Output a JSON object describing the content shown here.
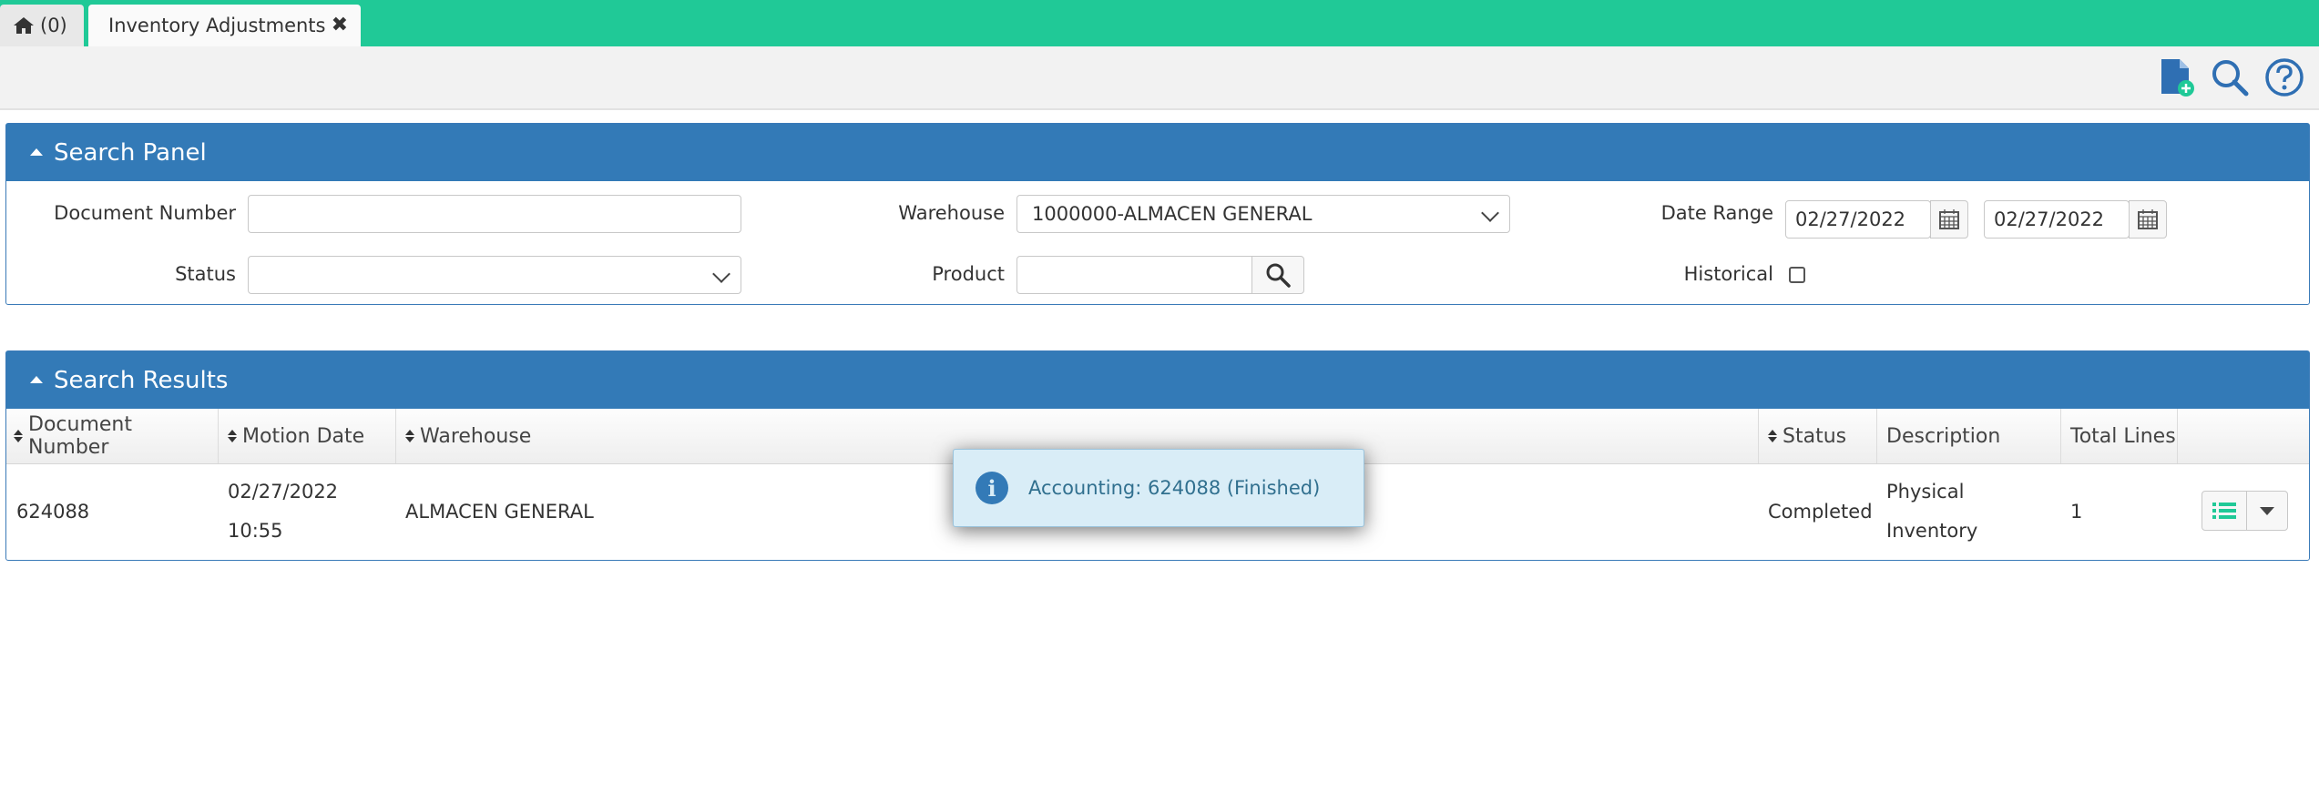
{
  "tabs": {
    "home_label": "(0)",
    "active_label": "Inventory Adjustments",
    "close_glyph": "✖"
  },
  "toolbar": {
    "icons": [
      "new-document-icon",
      "search-icon",
      "help-icon"
    ],
    "accent": "#337ab7"
  },
  "search_panel": {
    "title": "Search Panel",
    "document_number": {
      "label": "Document Number",
      "value": ""
    },
    "warehouse": {
      "label": "Warehouse",
      "value": "1000000-ALMACEN GENERAL"
    },
    "date_range": {
      "label": "Date Range",
      "from": "02/27/2022",
      "to": "02/27/2022"
    },
    "status": {
      "label": "Status",
      "value": ""
    },
    "product": {
      "label": "Product",
      "value": ""
    },
    "historical": {
      "label": "Historical",
      "checked": false
    }
  },
  "results_panel": {
    "title": "Search Results",
    "columns": [
      "Document Number",
      "Motion Date",
      "Warehouse",
      "Status",
      "Description",
      "Total Lines"
    ],
    "rows": [
      {
        "document_number": "624088",
        "motion_date": "02/27/2022",
        "motion_time": "10:55",
        "warehouse": "ALMACEN GENERAL",
        "status": "Completed",
        "description_line1": "Physical",
        "description_line2": "Inventory",
        "total_lines": "1"
      }
    ]
  },
  "notification": {
    "icon": "info-icon",
    "text": "Accounting: 624088 (Finished)"
  },
  "colors": {
    "top_bar": "#20c997",
    "panel_header": "#337ab7",
    "toast_bg": "#d9edf7",
    "toast_text": "#31708f"
  }
}
